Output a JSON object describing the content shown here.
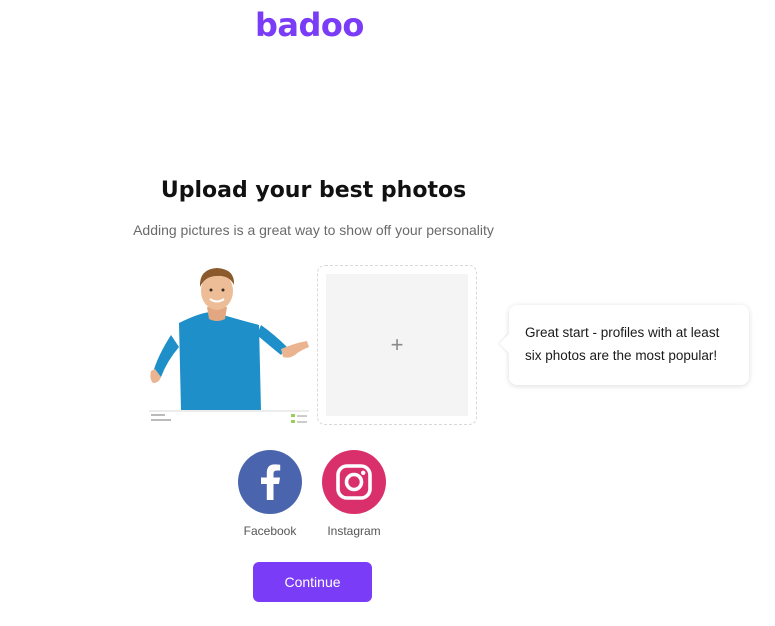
{
  "brand": {
    "name": "badoo",
    "color": "#7a3cf6"
  },
  "header": {
    "title": "Upload your best photos",
    "subtitle": "Adding pictures is a great way to show off your personality"
  },
  "photos": {
    "uploaded_count": 1,
    "add_slot_icon": "plus-icon",
    "add_slot_symbol": "+"
  },
  "tooltip": {
    "line1": "Great start - profiles with at least",
    "line2": "six photos are the most popular!"
  },
  "social": [
    {
      "label": "Facebook",
      "icon": "facebook-icon",
      "color": "#4a65ad"
    },
    {
      "label": "Instagram",
      "icon": "instagram-icon",
      "color": "#d9306c"
    }
  ],
  "actions": {
    "continue_label": "Continue",
    "continue_color": "#7a3cf6"
  }
}
